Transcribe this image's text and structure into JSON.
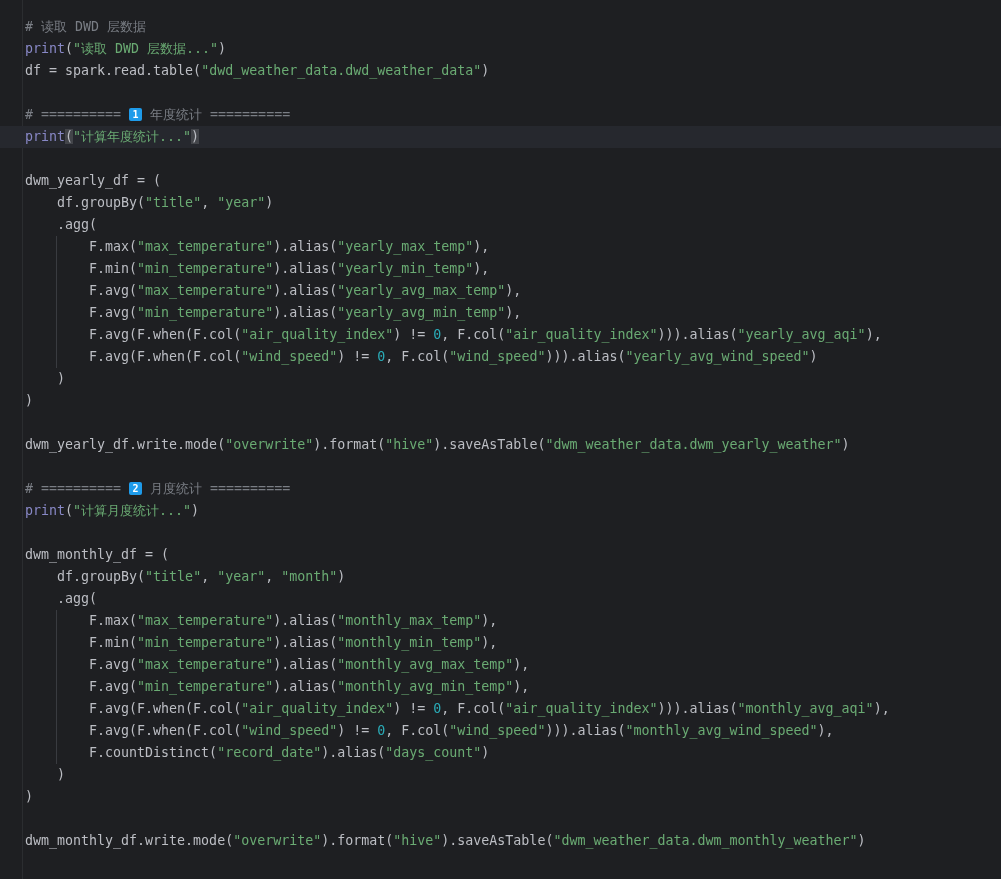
{
  "editor": {
    "lines": [
      {
        "current": false,
        "tokens": [
          {
            "kind": "comment",
            "text": "# 读取 DWD 层数据"
          }
        ]
      },
      {
        "current": false,
        "tokens": [
          {
            "kind": "builtin",
            "text": "print"
          },
          {
            "kind": "plain",
            "text": "("
          },
          {
            "kind": "string",
            "text": "\"读取 DWD 层数据...\""
          },
          {
            "kind": "plain",
            "text": ")"
          }
        ]
      },
      {
        "current": false,
        "tokens": [
          {
            "kind": "plain",
            "text": "df = spark.read.table("
          },
          {
            "kind": "string",
            "text": "\"dwd_weather_data.dwd_weather_data\""
          },
          {
            "kind": "plain",
            "text": ")"
          }
        ]
      },
      {
        "current": false
      },
      {
        "current": false,
        "tokens": [
          {
            "kind": "comment",
            "text": "# ========== "
          },
          {
            "kind": "badge",
            "text": "1"
          },
          {
            "kind": "comment",
            "text": " 年度统计 =========="
          }
        ]
      },
      {
        "current": true,
        "tokens": [
          {
            "kind": "builtin",
            "text": "print"
          },
          {
            "kind": "match",
            "text": "("
          },
          {
            "kind": "string",
            "text": "\"计算年度统计...\""
          },
          {
            "kind": "match",
            "text": ")"
          }
        ]
      },
      {
        "current": false
      },
      {
        "current": false,
        "tokens": [
          {
            "kind": "plain",
            "text": "dwm_yearly_df = ("
          }
        ]
      },
      {
        "current": false,
        "tokens": [
          {
            "kind": "plain",
            "text": "    df.groupBy("
          },
          {
            "kind": "string",
            "text": "\"title\""
          },
          {
            "kind": "plain",
            "text": ", "
          },
          {
            "kind": "string",
            "text": "\"year\""
          },
          {
            "kind": "plain",
            "text": ")"
          }
        ]
      },
      {
        "current": false,
        "tokens": [
          {
            "kind": "plain",
            "text": "    .agg("
          }
        ]
      },
      {
        "current": false,
        "tokens": [
          {
            "kind": "plain",
            "text": "        F.max("
          },
          {
            "kind": "string",
            "text": "\"max_temperature\""
          },
          {
            "kind": "plain",
            "text": ").alias("
          },
          {
            "kind": "string",
            "text": "\"yearly_max_temp\""
          },
          {
            "kind": "plain",
            "text": "),"
          }
        ]
      },
      {
        "current": false,
        "tokens": [
          {
            "kind": "plain",
            "text": "        F.min("
          },
          {
            "kind": "string",
            "text": "\"min_temperature\""
          },
          {
            "kind": "plain",
            "text": ").alias("
          },
          {
            "kind": "string",
            "text": "\"yearly_min_temp\""
          },
          {
            "kind": "plain",
            "text": "),"
          }
        ]
      },
      {
        "current": false,
        "tokens": [
          {
            "kind": "plain",
            "text": "        F.avg("
          },
          {
            "kind": "string",
            "text": "\"max_temperature\""
          },
          {
            "kind": "plain",
            "text": ").alias("
          },
          {
            "kind": "string",
            "text": "\"yearly_avg_max_temp\""
          },
          {
            "kind": "plain",
            "text": "),"
          }
        ]
      },
      {
        "current": false,
        "tokens": [
          {
            "kind": "plain",
            "text": "        F.avg("
          },
          {
            "kind": "string",
            "text": "\"min_temperature\""
          },
          {
            "kind": "plain",
            "text": ").alias("
          },
          {
            "kind": "string",
            "text": "\"yearly_avg_min_temp\""
          },
          {
            "kind": "plain",
            "text": "),"
          }
        ]
      },
      {
        "current": false,
        "tokens": [
          {
            "kind": "plain",
            "text": "        F.avg(F.when(F.col("
          },
          {
            "kind": "string",
            "text": "\"air_quality_index\""
          },
          {
            "kind": "plain",
            "text": ") != "
          },
          {
            "kind": "number",
            "text": "0"
          },
          {
            "kind": "plain",
            "text": ", F.col("
          },
          {
            "kind": "string",
            "text": "\"air_quality_index\""
          },
          {
            "kind": "plain",
            "text": "))).alias("
          },
          {
            "kind": "string",
            "text": "\"yearly_avg_aqi\""
          },
          {
            "kind": "plain",
            "text": "),"
          }
        ]
      },
      {
        "current": false,
        "tokens": [
          {
            "kind": "plain",
            "text": "        F.avg(F.when(F.col("
          },
          {
            "kind": "string",
            "text": "\"wind_speed\""
          },
          {
            "kind": "plain",
            "text": ") != "
          },
          {
            "kind": "number",
            "text": "0"
          },
          {
            "kind": "plain",
            "text": ", F.col("
          },
          {
            "kind": "string",
            "text": "\"wind_speed\""
          },
          {
            "kind": "plain",
            "text": "))).alias("
          },
          {
            "kind": "string",
            "text": "\"yearly_avg_wind_speed\""
          },
          {
            "kind": "plain",
            "text": ")"
          }
        ]
      },
      {
        "current": false,
        "tokens": [
          {
            "kind": "plain",
            "text": "    )"
          }
        ]
      },
      {
        "current": false,
        "tokens": [
          {
            "kind": "plain",
            "text": ")"
          }
        ]
      },
      {
        "current": false
      },
      {
        "current": false,
        "tokens": [
          {
            "kind": "plain",
            "text": "dwm_yearly_df.write.mode("
          },
          {
            "kind": "string",
            "text": "\"overwrite\""
          },
          {
            "kind": "plain",
            "text": ").format("
          },
          {
            "kind": "string",
            "text": "\"hive\""
          },
          {
            "kind": "plain",
            "text": ").saveAsTable("
          },
          {
            "kind": "string",
            "text": "\"dwm_weather_data.dwm_yearly_weather\""
          },
          {
            "kind": "plain",
            "text": ")"
          }
        ]
      },
      {
        "current": false
      },
      {
        "current": false,
        "tokens": [
          {
            "kind": "comment",
            "text": "# ========== "
          },
          {
            "kind": "badge",
            "text": "2"
          },
          {
            "kind": "comment",
            "text": " 月度统计 =========="
          }
        ]
      },
      {
        "current": false,
        "tokens": [
          {
            "kind": "builtin",
            "text": "print"
          },
          {
            "kind": "plain",
            "text": "("
          },
          {
            "kind": "string",
            "text": "\"计算月度统计...\""
          },
          {
            "kind": "plain",
            "text": ")"
          }
        ]
      },
      {
        "current": false
      },
      {
        "current": false,
        "tokens": [
          {
            "kind": "plain",
            "text": "dwm_monthly_df = ("
          }
        ]
      },
      {
        "current": false,
        "tokens": [
          {
            "kind": "plain",
            "text": "    df.groupBy("
          },
          {
            "kind": "string",
            "text": "\"title\""
          },
          {
            "kind": "plain",
            "text": ", "
          },
          {
            "kind": "string",
            "text": "\"year\""
          },
          {
            "kind": "plain",
            "text": ", "
          },
          {
            "kind": "string",
            "text": "\"month\""
          },
          {
            "kind": "plain",
            "text": ")"
          }
        ]
      },
      {
        "current": false,
        "tokens": [
          {
            "kind": "plain",
            "text": "    .agg("
          }
        ]
      },
      {
        "current": false,
        "tokens": [
          {
            "kind": "plain",
            "text": "        F.max("
          },
          {
            "kind": "string",
            "text": "\"max_temperature\""
          },
          {
            "kind": "plain",
            "text": ").alias("
          },
          {
            "kind": "string",
            "text": "\"monthly_max_temp\""
          },
          {
            "kind": "plain",
            "text": "),"
          }
        ]
      },
      {
        "current": false,
        "tokens": [
          {
            "kind": "plain",
            "text": "        F.min("
          },
          {
            "kind": "string",
            "text": "\"min_temperature\""
          },
          {
            "kind": "plain",
            "text": ").alias("
          },
          {
            "kind": "string",
            "text": "\"monthly_min_temp\""
          },
          {
            "kind": "plain",
            "text": "),"
          }
        ]
      },
      {
        "current": false,
        "tokens": [
          {
            "kind": "plain",
            "text": "        F.avg("
          },
          {
            "kind": "string",
            "text": "\"max_temperature\""
          },
          {
            "kind": "plain",
            "text": ").alias("
          },
          {
            "kind": "string",
            "text": "\"monthly_avg_max_temp\""
          },
          {
            "kind": "plain",
            "text": "),"
          }
        ]
      },
      {
        "current": false,
        "tokens": [
          {
            "kind": "plain",
            "text": "        F.avg("
          },
          {
            "kind": "string",
            "text": "\"min_temperature\""
          },
          {
            "kind": "plain",
            "text": ").alias("
          },
          {
            "kind": "string",
            "text": "\"monthly_avg_min_temp\""
          },
          {
            "kind": "plain",
            "text": "),"
          }
        ]
      },
      {
        "current": false,
        "tokens": [
          {
            "kind": "plain",
            "text": "        F.avg(F.when(F.col("
          },
          {
            "kind": "string",
            "text": "\"air_quality_index\""
          },
          {
            "kind": "plain",
            "text": ") != "
          },
          {
            "kind": "number",
            "text": "0"
          },
          {
            "kind": "plain",
            "text": ", F.col("
          },
          {
            "kind": "string",
            "text": "\"air_quality_index\""
          },
          {
            "kind": "plain",
            "text": "))).alias("
          },
          {
            "kind": "string",
            "text": "\"monthly_avg_aqi\""
          },
          {
            "kind": "plain",
            "text": "),"
          }
        ]
      },
      {
        "current": false,
        "tokens": [
          {
            "kind": "plain",
            "text": "        F.avg(F.when(F.col("
          },
          {
            "kind": "string",
            "text": "\"wind_speed\""
          },
          {
            "kind": "plain",
            "text": ") != "
          },
          {
            "kind": "number",
            "text": "0"
          },
          {
            "kind": "plain",
            "text": ", F.col("
          },
          {
            "kind": "string",
            "text": "\"wind_speed\""
          },
          {
            "kind": "plain",
            "text": "))).alias("
          },
          {
            "kind": "string",
            "text": "\"monthly_avg_wind_speed\""
          },
          {
            "kind": "plain",
            "text": "),"
          }
        ]
      },
      {
        "current": false,
        "tokens": [
          {
            "kind": "plain",
            "text": "        F.countDistinct("
          },
          {
            "kind": "string",
            "text": "\"record_date\""
          },
          {
            "kind": "plain",
            "text": ").alias("
          },
          {
            "kind": "string",
            "text": "\"days_count\""
          },
          {
            "kind": "plain",
            "text": ")"
          }
        ]
      },
      {
        "current": false,
        "tokens": [
          {
            "kind": "plain",
            "text": "    )"
          }
        ]
      },
      {
        "current": false,
        "tokens": [
          {
            "kind": "plain",
            "text": ")"
          }
        ]
      },
      {
        "current": false
      },
      {
        "current": false,
        "tokens": [
          {
            "kind": "plain",
            "text": "dwm_monthly_df.write.mode("
          },
          {
            "kind": "string",
            "text": "\"overwrite\""
          },
          {
            "kind": "plain",
            "text": ").format("
          },
          {
            "kind": "string",
            "text": "\"hive\""
          },
          {
            "kind": "plain",
            "text": ").saveAsTable("
          },
          {
            "kind": "string",
            "text": "\"dwm_weather_data.dwm_monthly_weather\""
          },
          {
            "kind": "plain",
            "text": ")"
          }
        ]
      }
    ]
  }
}
